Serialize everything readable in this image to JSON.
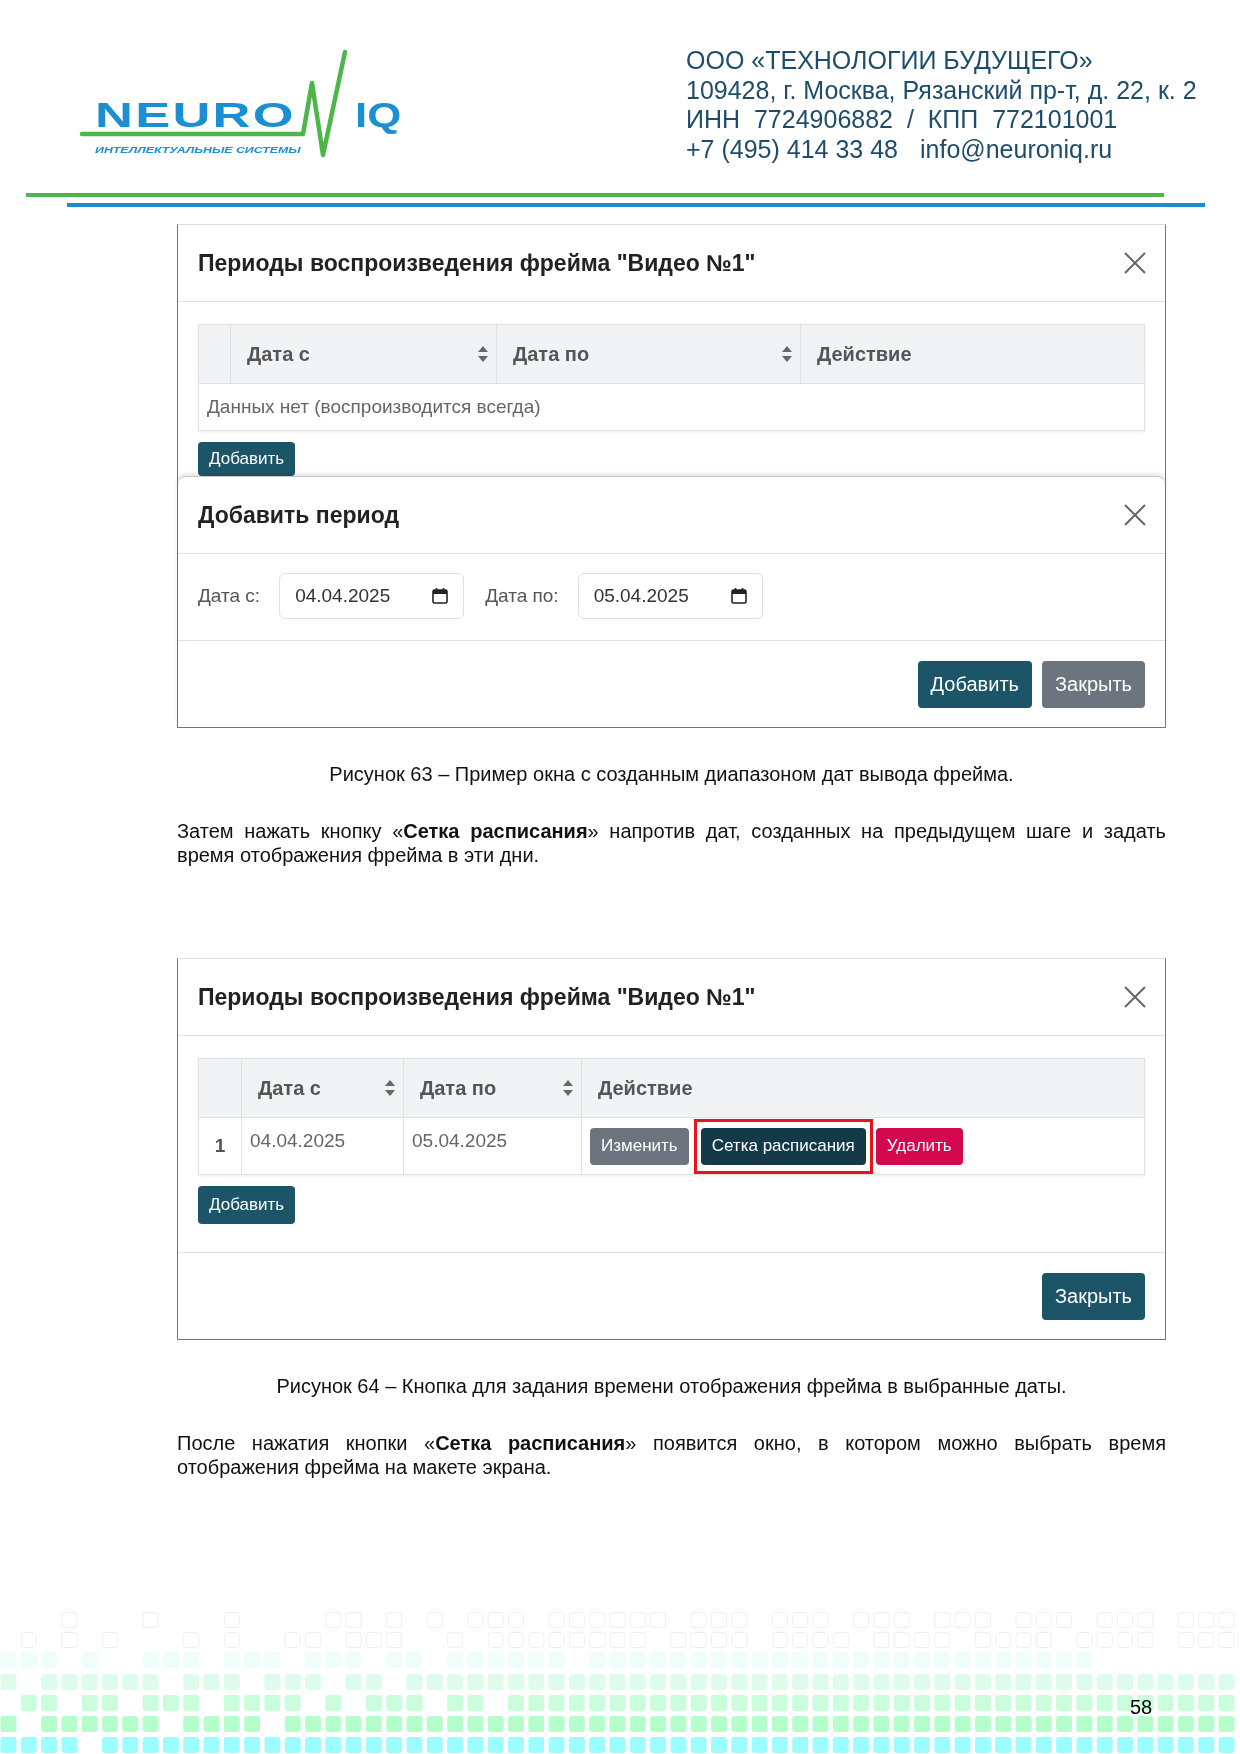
{
  "header": {
    "logo": {
      "wordmark": [
        "NEURO",
        "IQ"
      ],
      "tagline": "ИНТЕЛЛЕКТУАЛЬНЫЕ СИСТЕМЫ"
    },
    "company": {
      "lines": [
        "ООО «ТЕХНОЛОГИИ БУДУЩЕГО»",
        "109428, г. Москва, Рязанский пр-т, д. 22, к. 2",
        "ИНН  7724906882  /  КПП  772101001"
      ],
      "phone": "+7 (495) 414 33 48",
      "email": "info@neuroniq.ru"
    }
  },
  "content": [
    {
      "kind": "figure",
      "dialogs": [
        {
          "title": "Периоды воспроизведения фрейма \"Видео №1\"",
          "table": {
            "columns": [
              {
                "label": "Дата с",
                "sortable": true
              },
              {
                "label": "Дата по",
                "sortable": true
              },
              {
                "label": "Действие",
                "sortable": false
              }
            ],
            "empty_text": "Данных нет (воспроизводится всегда)"
          },
          "add_button": "Добавить"
        },
        {
          "title": "Добавить период",
          "fields": [
            {
              "label": "Дата с:",
              "value": "04.04.2025"
            },
            {
              "label": "Дата по:",
              "value": "05.04.2025"
            }
          ],
          "buttons": [
            {
              "label": "Добавить",
              "kind": "primary"
            },
            {
              "label": "Закрыть",
              "kind": "secondary"
            }
          ]
        }
      ]
    },
    {
      "kind": "caption",
      "text": "Рисунок 63 – Пример окна с созданным диапазоном дат вывода фрейма."
    },
    {
      "kind": "paragraph",
      "text": "Затем нажать кнопку «**Сетка расписания**» напротив дат, созданных на предыдущем шаге и задать время отображения фрейма в эти дни."
    },
    {
      "kind": "figure",
      "dialogs": [
        {
          "title": "Периоды воспроизведения фрейма \"Видео №1\"",
          "table": {
            "columns": [
              {
                "label": "Дата с",
                "sortable": true
              },
              {
                "label": "Дата по",
                "sortable": true
              },
              {
                "label": "Действие",
                "sortable": false
              }
            ],
            "rows": [
              {
                "number": "1",
                "cells": [
                  "04.04.2025",
                  "05.04.2025"
                ],
                "actions": [
                  {
                    "label": "Изменить",
                    "kind": "secondary",
                    "highlighted": false
                  },
                  {
                    "label": "Сетка расписания",
                    "kind": "dark",
                    "highlighted": true
                  },
                  {
                    "label": "Удалить",
                    "kind": "danger",
                    "highlighted": false
                  }
                ]
              }
            ]
          },
          "add_button": "Добавить",
          "buttons": [
            {
              "label": "Закрыть",
              "kind": "primary"
            }
          ]
        }
      ]
    },
    {
      "kind": "caption",
      "text": "Рисунок 64 – Кнопка для задания времени отображения фрейма в выбранные даты."
    },
    {
      "kind": "paragraph",
      "text": "После нажатия кнопки «**Сетка расписания**» появится окно, в котором можно выбрать время отображения фрейма на макете экрана."
    }
  ],
  "footer": {
    "page_number": "58"
  }
}
